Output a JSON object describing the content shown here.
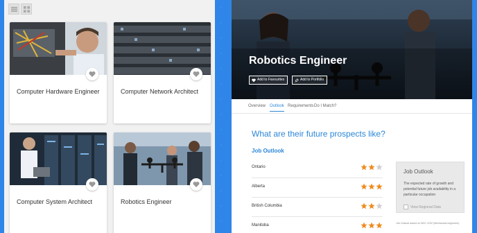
{
  "cards": [
    {
      "title": "Computer Hardware Engineer"
    },
    {
      "title": "Computer Network Architect"
    },
    {
      "title": "Computer System Architect"
    },
    {
      "title": "Robotics Engineer"
    }
  ],
  "job": {
    "title": "Robotics Engineer",
    "add_favourites": "Add to Favourites",
    "add_portfolio": "Add to Portfolio",
    "tabs": [
      "Overview",
      "Outlook",
      "Requirements",
      "Do I Match?"
    ],
    "active_tab": "Outlook",
    "question": "What are their future prospects like?",
    "outlook_heading": "Job Outlook",
    "rows": [
      {
        "province": "Ontario",
        "stars": 2
      },
      {
        "province": "Alberta",
        "stars": 3
      },
      {
        "province": "British Columbia",
        "stars": 2
      },
      {
        "province": "Manitoba",
        "stars": 3
      }
    ],
    "side_title": "Job Outlook",
    "side_desc": "The expected rate of growth and potential future job availability in a particular occupation",
    "side_link": "View Regional Data",
    "footnote": "Job Outlook based on NOC 2232 (Mechanical engineers)"
  },
  "colors": {
    "accent": "#2b86d8",
    "star_on": "#f08a1c",
    "star_off": "#cfcfcf",
    "background": "#2f86e8"
  }
}
